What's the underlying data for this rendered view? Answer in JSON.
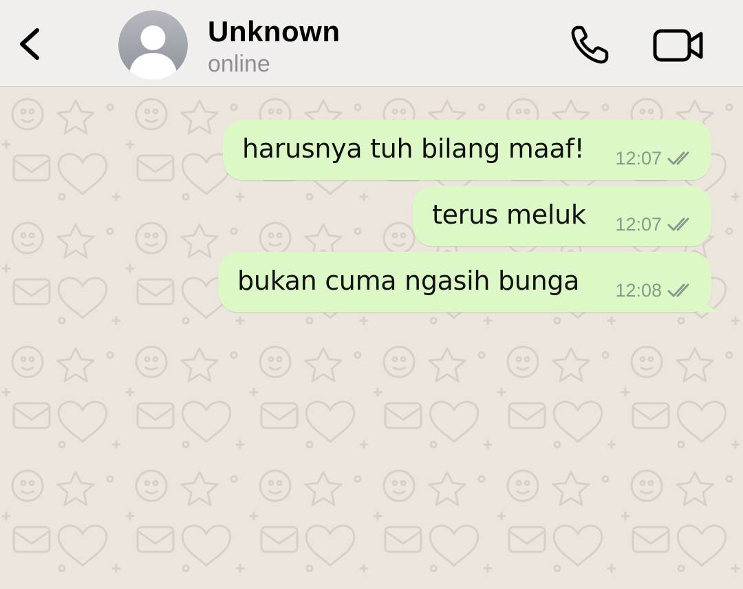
{
  "header": {
    "contact_name": "Unknown",
    "status": "online",
    "icons": {
      "back": "chevron-left-icon",
      "avatar": "default-avatar-icon",
      "call": "phone-icon",
      "video": "video-camera-icon"
    }
  },
  "messages": [
    {
      "text": "harusnya tuh bilang maaf!",
      "time": "12:07",
      "status": "read",
      "direction": "outgoing"
    },
    {
      "text": "terus meluk",
      "time": "12:07",
      "status": "read",
      "direction": "outgoing"
    },
    {
      "text": "bukan cuma ngasih bunga",
      "time": "12:08",
      "status": "read",
      "direction": "outgoing"
    }
  ],
  "colors": {
    "header_bg": "#f1efed",
    "chat_bg": "#ece5dd",
    "outgoing_bubble": "#dcf8c6",
    "read_ticks": "#8a9a8a",
    "avatar_bg": "#a8abb2"
  }
}
